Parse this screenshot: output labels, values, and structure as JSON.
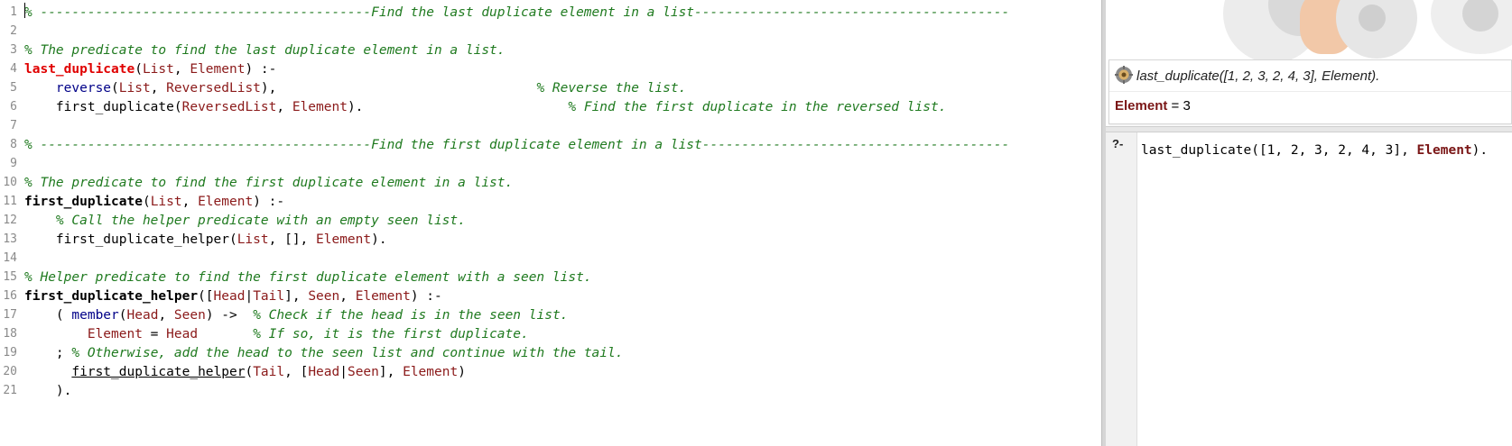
{
  "editor": {
    "lines": [
      {
        "n": "1",
        "segs": [
          {
            "t": "% ------------------------------------------Find the last duplicate element in a list----------------------------------------",
            "c": "cm"
          }
        ]
      },
      {
        "n": "2",
        "segs": []
      },
      {
        "n": "3",
        "segs": [
          {
            "t": "% The predicate to find the last duplicate element in a list.",
            "c": "cm"
          }
        ]
      },
      {
        "n": "4",
        "segs": [
          {
            "t": "last_duplicate",
            "c": "pred-red"
          },
          {
            "t": "(",
            "c": ""
          },
          {
            "t": "List",
            "c": "var"
          },
          {
            "t": ", ",
            "c": ""
          },
          {
            "t": "Element",
            "c": "var"
          },
          {
            "t": ") :-",
            "c": ""
          }
        ]
      },
      {
        "n": "5",
        "segs": [
          {
            "t": "    ",
            "c": ""
          },
          {
            "t": "reverse",
            "c": "builtin"
          },
          {
            "t": "(",
            "c": ""
          },
          {
            "t": "List",
            "c": "var"
          },
          {
            "t": ", ",
            "c": ""
          },
          {
            "t": "ReversedList",
            "c": "var"
          },
          {
            "t": "),                                 ",
            "c": ""
          },
          {
            "t": "% Reverse the list.",
            "c": "cm"
          }
        ]
      },
      {
        "n": "6",
        "segs": [
          {
            "t": "    first_duplicate(",
            "c": ""
          },
          {
            "t": "ReversedList",
            "c": "var"
          },
          {
            "t": ", ",
            "c": ""
          },
          {
            "t": "Element",
            "c": "var"
          },
          {
            "t": ").                          ",
            "c": ""
          },
          {
            "t": "% Find the first duplicate in the reversed list.",
            "c": "cm"
          }
        ]
      },
      {
        "n": "7",
        "segs": []
      },
      {
        "n": "8",
        "segs": [
          {
            "t": "% ------------------------------------------Find the first duplicate element in a list---------------------------------------",
            "c": "cm"
          }
        ]
      },
      {
        "n": "9",
        "segs": []
      },
      {
        "n": "10",
        "segs": [
          {
            "t": "% The predicate to find the first duplicate element in a list.",
            "c": "cm"
          }
        ]
      },
      {
        "n": "11",
        "segs": [
          {
            "t": "first_duplicate",
            "c": "pred-def"
          },
          {
            "t": "(",
            "c": ""
          },
          {
            "t": "List",
            "c": "var"
          },
          {
            "t": ", ",
            "c": ""
          },
          {
            "t": "Element",
            "c": "var"
          },
          {
            "t": ") :-",
            "c": ""
          }
        ]
      },
      {
        "n": "12",
        "segs": [
          {
            "t": "    ",
            "c": ""
          },
          {
            "t": "% Call the helper predicate with an empty seen list.",
            "c": "cm"
          }
        ]
      },
      {
        "n": "13",
        "segs": [
          {
            "t": "    first_duplicate_helper(",
            "c": ""
          },
          {
            "t": "List",
            "c": "var"
          },
          {
            "t": ", [], ",
            "c": ""
          },
          {
            "t": "Element",
            "c": "var"
          },
          {
            "t": ").",
            "c": ""
          }
        ]
      },
      {
        "n": "14",
        "segs": []
      },
      {
        "n": "15",
        "segs": [
          {
            "t": "% Helper predicate to find the first duplicate element with a seen list.",
            "c": "cm"
          }
        ]
      },
      {
        "n": "16",
        "segs": [
          {
            "t": "first_duplicate_helper",
            "c": "pred-def"
          },
          {
            "t": "([",
            "c": ""
          },
          {
            "t": "Head",
            "c": "var"
          },
          {
            "t": "|",
            "c": ""
          },
          {
            "t": "Tail",
            "c": "var"
          },
          {
            "t": "], ",
            "c": ""
          },
          {
            "t": "Seen",
            "c": "var"
          },
          {
            "t": ", ",
            "c": ""
          },
          {
            "t": "Element",
            "c": "var"
          },
          {
            "t": ") :-",
            "c": ""
          }
        ]
      },
      {
        "n": "17",
        "segs": [
          {
            "t": "    ( ",
            "c": ""
          },
          {
            "t": "member",
            "c": "builtin"
          },
          {
            "t": "(",
            "c": ""
          },
          {
            "t": "Head",
            "c": "var"
          },
          {
            "t": ", ",
            "c": ""
          },
          {
            "t": "Seen",
            "c": "var"
          },
          {
            "t": ") ->  ",
            "c": ""
          },
          {
            "t": "% Check if the head is in the seen list.",
            "c": "cm"
          }
        ]
      },
      {
        "n": "18",
        "segs": [
          {
            "t": "        ",
            "c": ""
          },
          {
            "t": "Element",
            "c": "var"
          },
          {
            "t": " = ",
            "c": ""
          },
          {
            "t": "Head",
            "c": "var"
          },
          {
            "t": "       ",
            "c": ""
          },
          {
            "t": "% If so, it is the first duplicate.",
            "c": "cm"
          }
        ]
      },
      {
        "n": "19",
        "segs": [
          {
            "t": "    ; ",
            "c": ""
          },
          {
            "t": "% Otherwise, add the head to the seen list and continue with the tail.",
            "c": "cm"
          }
        ]
      },
      {
        "n": "20",
        "segs": [
          {
            "t": "      ",
            "c": ""
          },
          {
            "t": "first_duplicate_helper",
            "c": "ul"
          },
          {
            "t": "(",
            "c": ""
          },
          {
            "t": "Tail",
            "c": "var"
          },
          {
            "t": ", [",
            "c": ""
          },
          {
            "t": "Head",
            "c": "var"
          },
          {
            "t": "|",
            "c": ""
          },
          {
            "t": "Seen",
            "c": "var"
          },
          {
            "t": "], ",
            "c": ""
          },
          {
            "t": "Element",
            "c": "var"
          },
          {
            "t": ")",
            "c": ""
          }
        ]
      },
      {
        "n": "21",
        "segs": [
          {
            "t": "    ).",
            "c": ""
          }
        ]
      }
    ]
  },
  "answer": {
    "query_text": "last_duplicate([1, 2, 3, 2, 4, 3], Element).",
    "result_var": "Element",
    "result_eq": " = 3"
  },
  "query_editor": {
    "prompt": "?-",
    "input_segs": [
      {
        "t": "last_duplicate([1, 2, 3, 2, 4, 3], ",
        "c": ""
      },
      {
        "t": "Element",
        "c": "var-b"
      },
      {
        "t": ").",
        "c": ""
      }
    ]
  },
  "colors": {
    "comment": "#1f7a1f",
    "variable": "#8b1a1a",
    "predicate_highlight": "#e00000",
    "builtin": "#000088"
  }
}
